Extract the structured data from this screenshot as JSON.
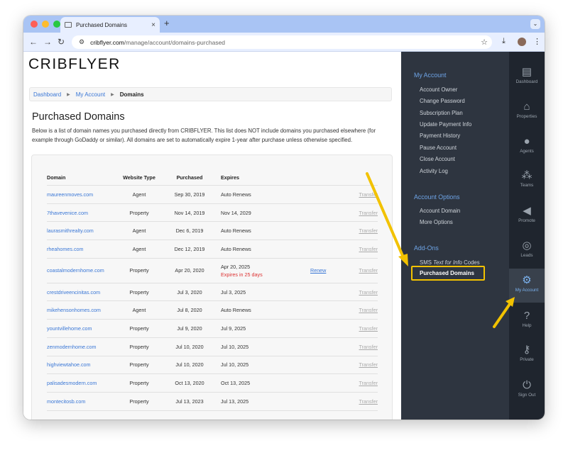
{
  "browser": {
    "tab_title": "Purchased Domains",
    "tab_close": "×",
    "new_tab": "+",
    "url_host": "cribflyer.com",
    "url_path": "/manage/account/domains-purchased"
  },
  "site": {
    "logo": "CRIBFLYER"
  },
  "breadcrumb": {
    "items": [
      "Dashboard",
      "My Account"
    ],
    "current": "Domains"
  },
  "page": {
    "title": "Purchased Domains",
    "description": "Below is a list of domain names you purchased directly from CRIBFLYER. This list does NOT include domains you purchased elsewhere (for example through GoDaddy or similar). All domains are set to automatically expire 1-year after purchase unless otherwise specified."
  },
  "table": {
    "headers": {
      "domain": "Domain",
      "type": "Website Type",
      "purchased": "Purchased",
      "expires": "Expires"
    },
    "renew_label": "Renew",
    "transfer_label": "Transfer",
    "rows": [
      {
        "domain": "maureenmoves.com",
        "type": "Agent",
        "purchased": "Sep 30, 2019",
        "expires": "Auto Renews",
        "warning": "",
        "renew": ""
      },
      {
        "domain": "7thavevenice.com",
        "type": "Property",
        "purchased": "Nov 14, 2019",
        "expires": "Nov 14, 2029",
        "warning": "",
        "renew": ""
      },
      {
        "domain": "laurasmithrealty.com",
        "type": "Agent",
        "purchased": "Dec 6, 2019",
        "expires": "Auto Renews",
        "warning": "",
        "renew": ""
      },
      {
        "domain": "rheahomes.com",
        "type": "Agent",
        "purchased": "Dec 12, 2019",
        "expires": "Auto Renews",
        "warning": "",
        "renew": ""
      },
      {
        "domain": "coastalmodernhome.com",
        "type": "Property",
        "purchased": "Apr 20, 2020",
        "expires": "Apr 20, 2025",
        "warning": "Expires in 25 days",
        "renew": "Renew"
      },
      {
        "domain": "crestdriveencinitas.com",
        "type": "Property",
        "purchased": "Jul 3, 2020",
        "expires": "Jul 3, 2025",
        "warning": "",
        "renew": ""
      },
      {
        "domain": "mikehensonhomes.com",
        "type": "Agent",
        "purchased": "Jul 8, 2020",
        "expires": "Auto Renews",
        "warning": "",
        "renew": ""
      },
      {
        "domain": "yountvillehome.com",
        "type": "Property",
        "purchased": "Jul 9, 2020",
        "expires": "Jul 9, 2025",
        "warning": "",
        "renew": ""
      },
      {
        "domain": "zenmodernhome.com",
        "type": "Property",
        "purchased": "Jul 10, 2020",
        "expires": "Jul 10, 2025",
        "warning": "",
        "renew": ""
      },
      {
        "domain": "highviewtahoe.com",
        "type": "Property",
        "purchased": "Jul 10, 2020",
        "expires": "Jul 10, 2025",
        "warning": "",
        "renew": ""
      },
      {
        "domain": "palisadesmodern.com",
        "type": "Property",
        "purchased": "Oct 13, 2020",
        "expires": "Oct 13, 2025",
        "warning": "",
        "renew": ""
      },
      {
        "domain": "montecitosb.com",
        "type": "Property",
        "purchased": "Jul 13, 2023",
        "expires": "Jul 13, 2025",
        "warning": "",
        "renew": ""
      }
    ]
  },
  "menu": {
    "my_account": {
      "title": "My Account",
      "items": [
        "Account Owner",
        "Change Password",
        "Subscription Plan",
        "Update Payment Info",
        "Payment History",
        "Pause Account",
        "Close Account",
        "Activity Log"
      ]
    },
    "account_options": {
      "title": "Account Options",
      "items": [
        "Account Domain",
        "More Options"
      ]
    },
    "add_ons": {
      "title": "Add-Ons",
      "sms_prefix": "SMS ",
      "sms_italic": "Text for Info",
      "sms_suffix": " Codes",
      "active_item": "Purchased Domains"
    }
  },
  "icon_bar": [
    {
      "label": "Dashboard",
      "icon": "dashboard-icon"
    },
    {
      "label": "Properties",
      "icon": "properties-icon"
    },
    {
      "label": "Agents",
      "icon": "agent-icon"
    },
    {
      "label": "Teams",
      "icon": "teams-icon"
    },
    {
      "label": "Promote",
      "icon": "megaphone-icon"
    },
    {
      "label": "Leads",
      "icon": "target-icon"
    },
    {
      "label": "My Account",
      "icon": "gear-icon"
    },
    {
      "label": "Help",
      "icon": "help-icon"
    },
    {
      "label": "Private",
      "icon": "key-icon"
    },
    {
      "label": "Sign Out",
      "icon": "power-icon"
    }
  ],
  "colors": {
    "accent": "#3a77d6",
    "menu_bg": "#2e3540",
    "iconbar_bg": "#1f252e",
    "highlight": "#f2c200",
    "warning": "#dd3333"
  }
}
